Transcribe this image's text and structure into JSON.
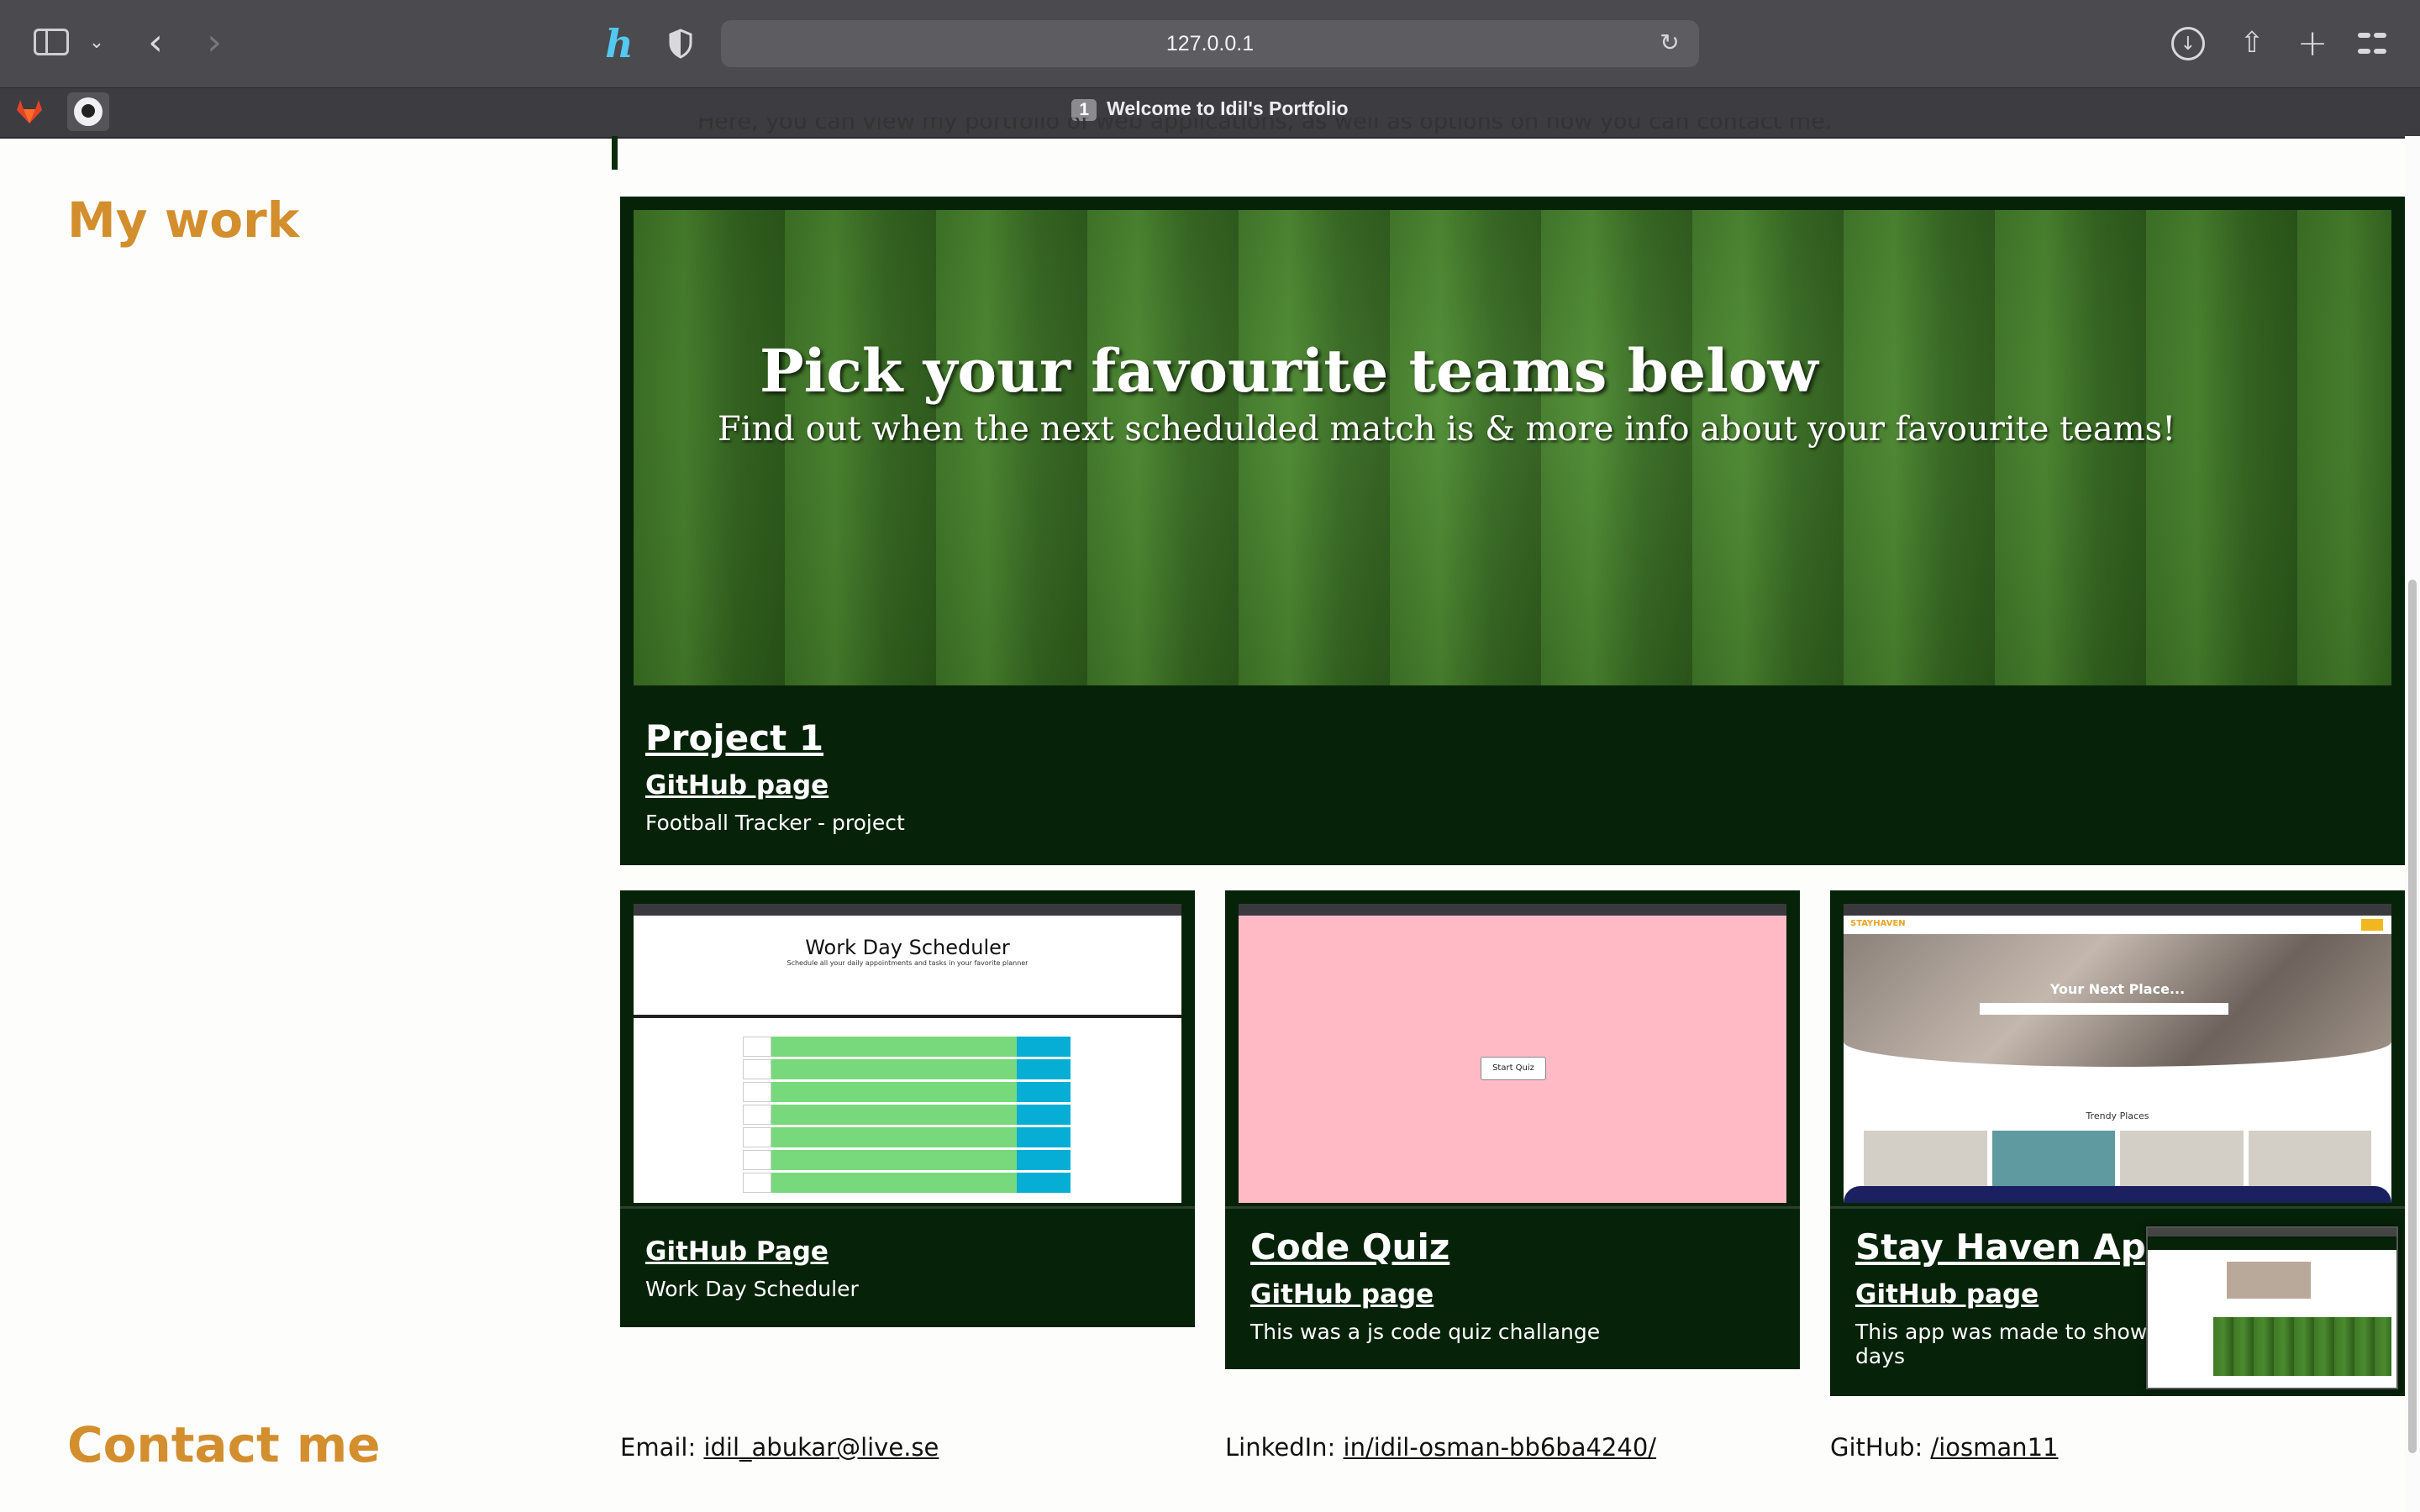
{
  "browser": {
    "url": "127.0.0.1",
    "tab_badge": "1",
    "tab_title": "Welcome to Idil's Portfolio",
    "h_glyph": "h"
  },
  "clipped_intro": "Here, you can view my portfolio of web applications, as well as options on how you can contact me.",
  "sections": {
    "work_title": "My work",
    "contact_title": "Contact me"
  },
  "main_project": {
    "banner_heading": "Pick your favourite teams below",
    "banner_sub": "Find out when the next schedulded match is & more info about your favourite teams!",
    "title": "Project 1",
    "link": "GitHub page",
    "desc": "Football Tracker - project"
  },
  "projects": [
    {
      "link": "GitHub Page",
      "desc": "Work Day Scheduler",
      "thumb_title": "Work Day Scheduler",
      "thumb_sub": "Schedule all your daily appointments and tasks in your favorite planner"
    },
    {
      "title": "Code Quiz",
      "link": "GitHub page",
      "desc": "This was a js code quiz challange",
      "thumb_button": "Start Quiz"
    },
    {
      "title": "Stay Haven App",
      "link": "GitHub page",
      "desc_line1": "This app was made to show we",
      "desc_line2": "days",
      "thumb_brand": "STAYHAVEN",
      "thumb_heading": "Your Next Place...",
      "thumb_trendy": "Trendy Places"
    }
  ],
  "contact": {
    "email_label": "Email:",
    "email": "idil_abukar@live.se",
    "linkedin_label": "LinkedIn:",
    "linkedin": "in/idil-osman-bb6ba4240/",
    "github_label": "GitHub:",
    "github": "/iosman11"
  },
  "colors": {
    "accent": "#d38e2e",
    "card_bg": "#06230a",
    "chrome": "#4a4a4f"
  }
}
